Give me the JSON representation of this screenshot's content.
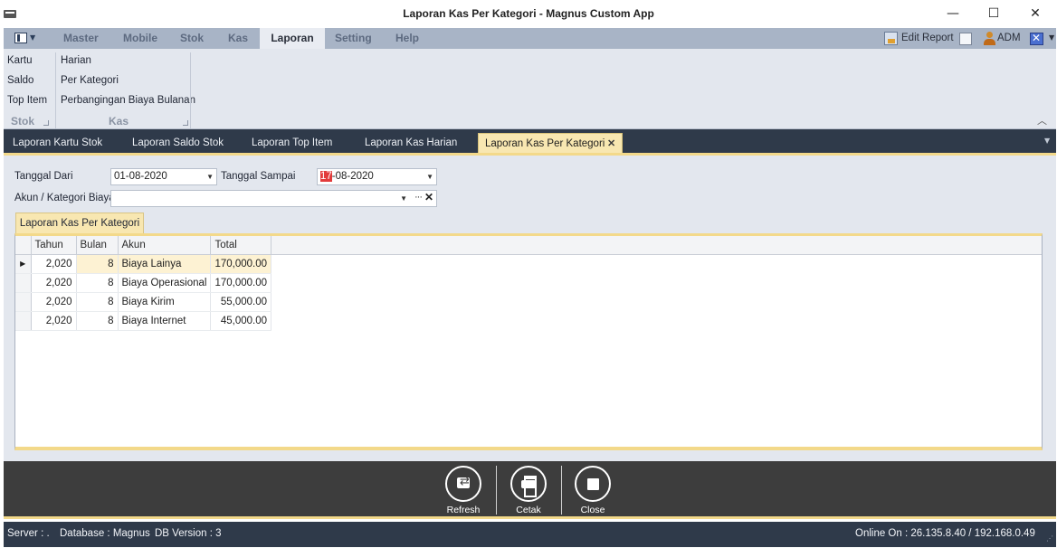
{
  "window": {
    "title": "Laporan Kas Per Kategori - Magnus Custom App",
    "minimize": "—",
    "maximize": "☐",
    "close": "✕"
  },
  "menu": {
    "tabs": [
      "Master",
      "Mobile",
      "Stok",
      "Kas",
      "Laporan",
      "Setting",
      "Help"
    ],
    "active_tab": "Laporan",
    "edit_report": "Edit Report",
    "user": "ADM"
  },
  "ribbon": {
    "stok_group": {
      "caption": "Stok",
      "items": [
        "Kartu",
        "Saldo",
        "Top Item"
      ]
    },
    "kas_group": {
      "caption": "Kas",
      "items": [
        "Harian",
        "Per Kategori",
        "Perbangingan Biaya Bulanan"
      ]
    }
  },
  "doc_tabs": [
    "Laporan Kartu Stok",
    "Laporan Saldo Stok",
    "Laporan Top Item",
    "Laporan Kas Harian",
    "Laporan Kas Per Kategori"
  ],
  "active_doc_tab": "Laporan Kas Per Kategori",
  "filter": {
    "tanggal_dari_label": "Tanggal Dari",
    "tanggal_dari_value": "01-08-2020",
    "tanggal_sampai_label": "Tanggal Sampai",
    "tanggal_sampai_day": "17",
    "tanggal_sampai_rest": "-08-2020",
    "akun_label": "Akun / Kategori Biaya",
    "akun_value": ""
  },
  "report_tab": "Laporan Kas Per Kategori",
  "grid": {
    "columns": [
      "Tahun",
      "Bulan",
      "Akun",
      "Total"
    ],
    "rows": [
      {
        "tahun": "2,020",
        "bulan": "8",
        "akun": "Biaya Lainya",
        "total": "170,000.00"
      },
      {
        "tahun": "2,020",
        "bulan": "8",
        "akun": "Biaya Operasional",
        "total": "170,000.00"
      },
      {
        "tahun": "2,020",
        "bulan": "8",
        "akun": "Biaya Kirim",
        "total": "55,000.00"
      },
      {
        "tahun": "2,020",
        "bulan": "8",
        "akun": "Biaya Internet",
        "total": "45,000.00"
      }
    ]
  },
  "actions": {
    "refresh": "Refresh",
    "cetak": "Cetak",
    "close": "Close"
  },
  "status": {
    "server": "Server : .",
    "database": "Database : Magnus",
    "db_version": "DB Version : 3",
    "online": "Online On : 26.135.8.40 / 192.168.0.49"
  },
  "colors": {
    "accent": "#f3d98a",
    "tab_active": "#f8e7b1",
    "strip": "#2f3a4a",
    "ribbon": "#e3e7ee"
  }
}
